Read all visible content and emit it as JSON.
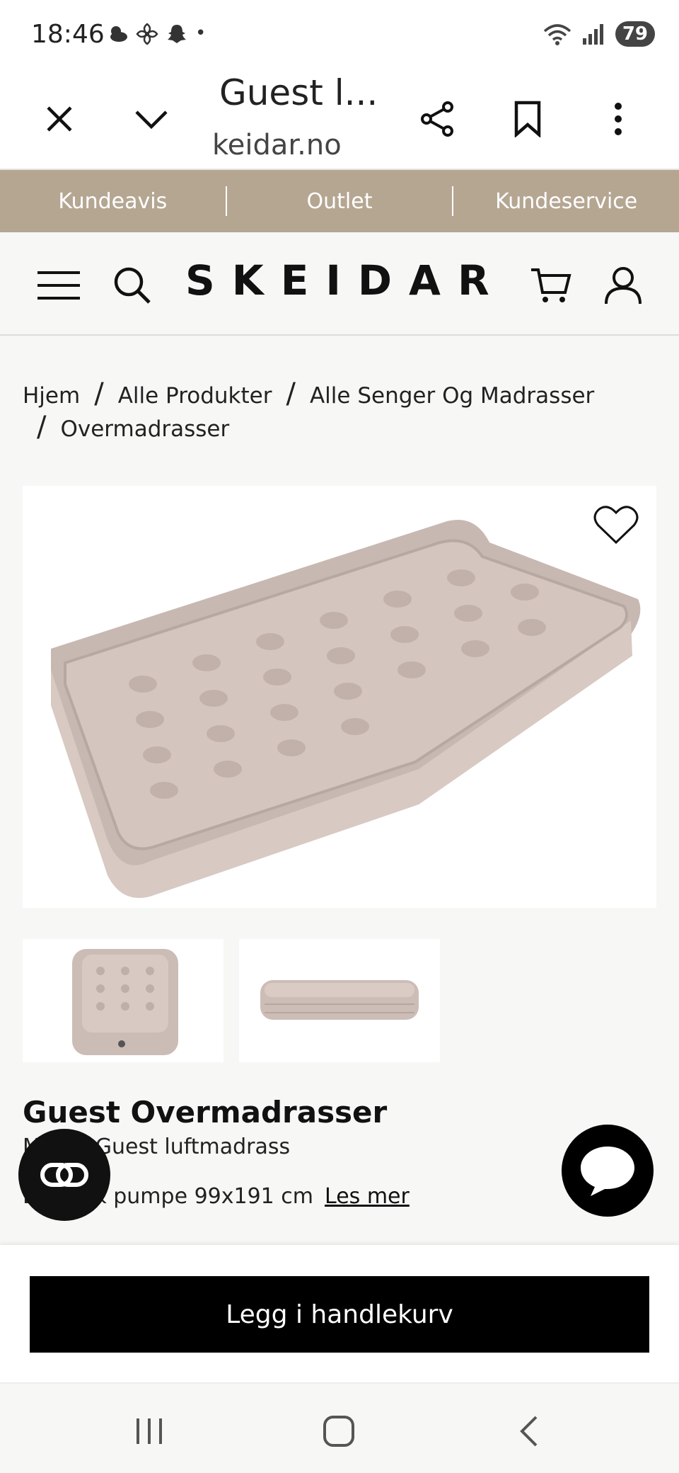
{
  "status_bar": {
    "time": "18:46",
    "battery": "79",
    "dot": "•"
  },
  "browser": {
    "title": "Guest l...",
    "domain": "keidar.no"
  },
  "promo_nav": {
    "items": [
      "Kundeavis",
      "Outlet",
      "Kundeservice"
    ]
  },
  "site": {
    "logo": "SKEIDAR"
  },
  "breadcrumb": {
    "items": [
      "Hjem",
      "Alle Produkter",
      "Alle Senger Og Madrasser",
      "Overmadrasser"
    ],
    "separator": "/"
  },
  "product": {
    "title": "Guest Overmadrasser",
    "model_text": "M      : Guest luftmadrass",
    "desc_text": "E       sk pumpe 99x191 cm",
    "read_more": "Les mer"
  },
  "cart": {
    "button_label": "Legg i handlekurv"
  },
  "colors": {
    "promo_bg": "#b5a692",
    "button_bg": "#000000",
    "mattress": "#cdbdb6"
  }
}
